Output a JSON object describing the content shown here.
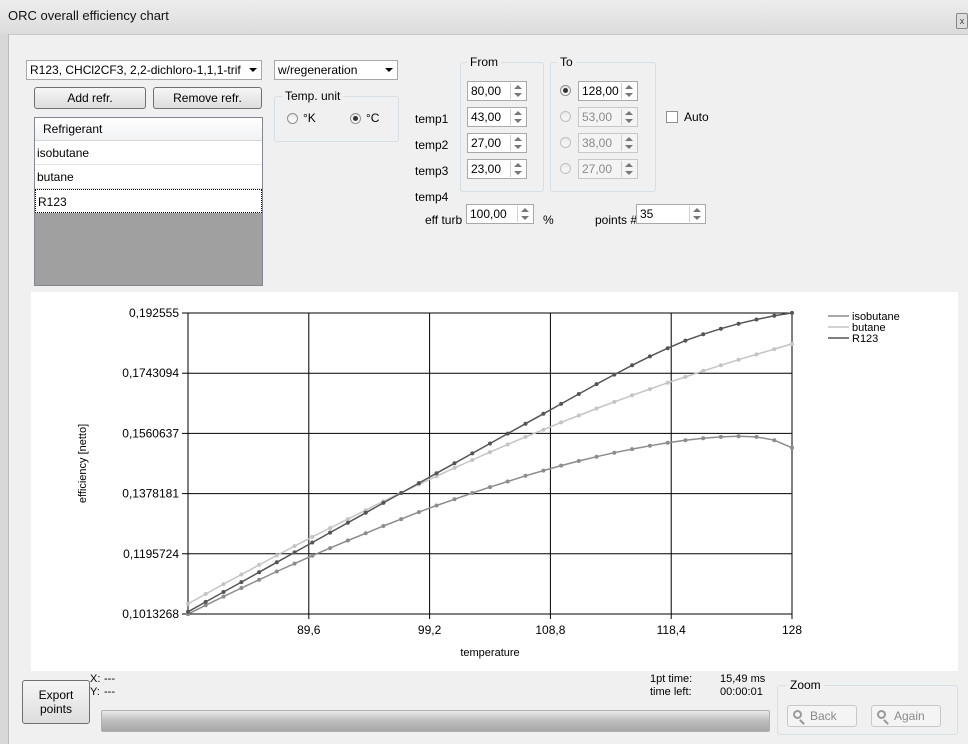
{
  "window": {
    "title": "ORC overall efficiency chart",
    "close_glyph": "x"
  },
  "refrigerant_combo": {
    "value": "R123, CHCl2CF3, 2,2-dichloro-1,1,1-trif"
  },
  "buttons": {
    "add": "Add refr.",
    "remove": "Remove refr.",
    "export": "Export points"
  },
  "refrigerant_list": {
    "header": "Refrigerant",
    "items": [
      "isobutane",
      "butane",
      "R123"
    ],
    "selected": "R123"
  },
  "mode_combo": {
    "value": "w/regeneration"
  },
  "temp_unit": {
    "label": "Temp. unit",
    "options": [
      "°K",
      "°C"
    ],
    "selected": "°C"
  },
  "range": {
    "from_label": "From",
    "to_label": "To",
    "rows": [
      {
        "label": "temp1",
        "from": "80,00",
        "to": "128,00",
        "to_selected": true,
        "to_enabled": true
      },
      {
        "label": "temp2",
        "from": "43,00",
        "to": "53,00",
        "to_selected": false,
        "to_enabled": false
      },
      {
        "label": "temp3",
        "from": "27,00",
        "to": "38,00",
        "to_selected": false,
        "to_enabled": false
      },
      {
        "label": "temp4",
        "from": "23,00",
        "to": "27,00",
        "to_selected": false,
        "to_enabled": false
      }
    ],
    "auto_label": "Auto",
    "auto_checked": false
  },
  "eff_turb": {
    "label": "eff turb",
    "value": "100,00",
    "unit": "%"
  },
  "points": {
    "label": "points #",
    "value": "35"
  },
  "chart_data": {
    "type": "line",
    "xlabel": "temperature",
    "ylabel": "efficiency [netto]",
    "x_ticks": [
      "89,6",
      "99,2",
      "108,8",
      "118,4",
      "128"
    ],
    "y_ticks": [
      "0,192555",
      "0,1743094",
      "0,1560637",
      "0,1378181",
      "0,1195724",
      "0,1013268"
    ],
    "xlim": [
      80,
      128
    ],
    "ylim": [
      0.1013268,
      0.192555
    ],
    "grid": true,
    "legend": "top-right",
    "x": [
      80,
      81.41,
      82.82,
      84.24,
      85.65,
      87.06,
      88.47,
      89.88,
      91.29,
      92.71,
      94.12,
      95.53,
      96.94,
      98.35,
      99.76,
      101.18,
      102.59,
      104,
      105.41,
      106.82,
      108.24,
      109.65,
      111.06,
      112.47,
      113.88,
      115.29,
      116.71,
      118.12,
      119.53,
      120.94,
      122.35,
      123.76,
      125.18,
      126.59,
      128
    ],
    "series": [
      {
        "name": "isobutane",
        "color": "#8c8c8c",
        "values": [
          0.1013,
          0.104,
          0.1066,
          0.1092,
          0.1117,
          0.1142,
          0.1166,
          0.119,
          0.1213,
          0.1236,
          0.1258,
          0.128,
          0.1301,
          0.1322,
          0.1342,
          0.1361,
          0.138,
          0.1398,
          0.1415,
          0.1432,
          0.1448,
          0.1463,
          0.1477,
          0.149,
          0.1502,
          0.1513,
          0.1523,
          0.1532,
          0.154,
          0.1546,
          0.155,
          0.1552,
          0.155,
          0.154,
          0.1517
        ]
      },
      {
        "name": "butane",
        "color": "#c4c4c4",
        "values": [
          0.1044,
          0.1074,
          0.1104,
          0.1133,
          0.1162,
          0.1191,
          0.1219,
          0.1247,
          0.1274,
          0.1301,
          0.1328,
          0.1355,
          0.1381,
          0.1406,
          0.1431,
          0.1456,
          0.148,
          0.1504,
          0.1527,
          0.155,
          0.1572,
          0.1594,
          0.1615,
          0.1636,
          0.1656,
          0.1676,
          0.1695,
          0.1714,
          0.1732,
          0.175,
          0.1767,
          0.1784,
          0.18,
          0.1816,
          0.1832
        ]
      },
      {
        "name": "R123",
        "color": "#555555",
        "values": [
          0.102,
          0.105,
          0.108,
          0.111,
          0.114,
          0.117,
          0.12,
          0.123,
          0.126,
          0.129,
          0.132,
          0.135,
          0.138,
          0.141,
          0.144,
          0.147,
          0.15,
          0.153,
          0.156,
          0.159,
          0.162,
          0.165,
          0.168,
          0.171,
          0.1739,
          0.1767,
          0.1794,
          0.1819,
          0.1842,
          0.1861,
          0.1878,
          0.1893,
          0.1906,
          0.1917,
          0.1926
        ]
      }
    ]
  },
  "status": {
    "x_label": "X:",
    "x_value": "---",
    "y_label": "Y:",
    "y_value": "---",
    "pt_time_label": "1pt time:",
    "pt_time_value": "15,49 ms",
    "time_left_label": "time left:",
    "time_left_value": "00:00:01"
  },
  "zoom": {
    "label": "Zoom",
    "back": "Back",
    "again": "Again"
  }
}
